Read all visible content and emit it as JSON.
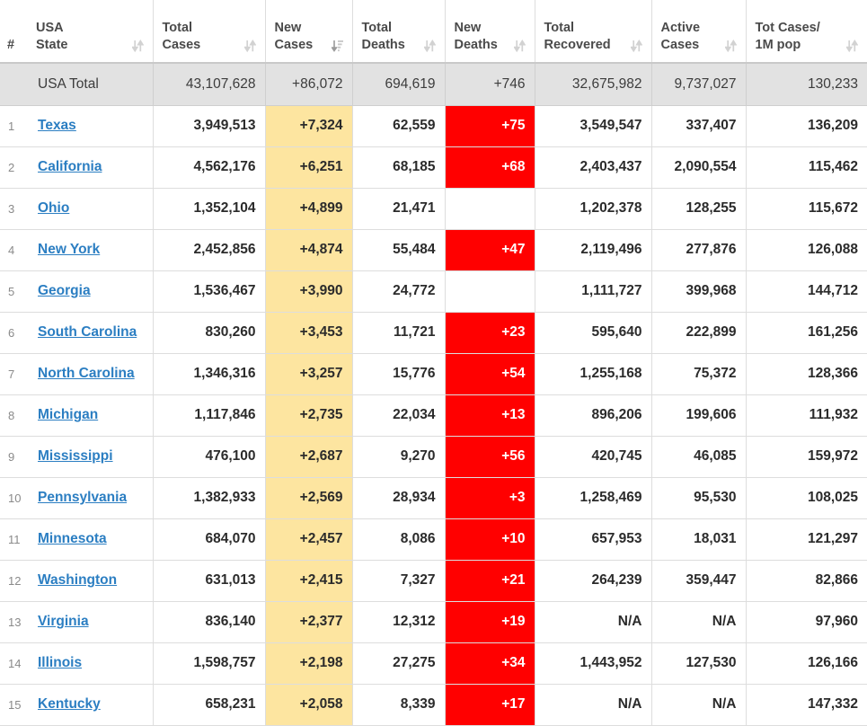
{
  "table": {
    "columns": [
      {
        "key": "rank",
        "label_line1": "",
        "label_line2": "#",
        "sort_icon": "none"
      },
      {
        "key": "state",
        "label_line1": "USA",
        "label_line2": "State",
        "sort_icon": "sort-updown-icon"
      },
      {
        "key": "tc",
        "label_line1": "Total",
        "label_line2": "Cases",
        "sort_icon": "sort-updown-icon"
      },
      {
        "key": "nc",
        "label_line1": "New",
        "label_line2": "Cases",
        "sort_icon": "sort-amount-desc-icon"
      },
      {
        "key": "td",
        "label_line1": "Total",
        "label_line2": "Deaths",
        "sort_icon": "sort-updown-icon"
      },
      {
        "key": "nd",
        "label_line1": "New",
        "label_line2": "Deaths",
        "sort_icon": "sort-updown-icon"
      },
      {
        "key": "tr",
        "label_line1": "Total",
        "label_line2": "Recovered",
        "sort_icon": "sort-updown-icon"
      },
      {
        "key": "ac",
        "label_line1": "Active",
        "label_line2": "Cases",
        "sort_icon": "sort-updown-icon"
      },
      {
        "key": "tcm",
        "label_line1": "Tot Cases/",
        "label_line2": "1M pop",
        "sort_icon": "sort-updown-icon"
      }
    ],
    "total_row": {
      "rank": "",
      "state": "USA Total",
      "total_cases": "43,107,628",
      "new_cases": "+86,072",
      "total_deaths": "694,619",
      "new_deaths": "+746",
      "total_recovered": "32,675,982",
      "active_cases": "9,737,027",
      "tot_cases_1m": "130,233"
    },
    "rows": [
      {
        "rank": "1",
        "state": "Texas",
        "total_cases": "3,949,513",
        "new_cases": "+7,324",
        "total_deaths": "62,559",
        "new_deaths": "+75",
        "total_recovered": "3,549,547",
        "active_cases": "337,407",
        "tot_cases_1m": "136,209"
      },
      {
        "rank": "2",
        "state": "California",
        "total_cases": "4,562,176",
        "new_cases": "+6,251",
        "total_deaths": "68,185",
        "new_deaths": "+68",
        "total_recovered": "2,403,437",
        "active_cases": "2,090,554",
        "tot_cases_1m": "115,462"
      },
      {
        "rank": "3",
        "state": "Ohio",
        "total_cases": "1,352,104",
        "new_cases": "+4,899",
        "total_deaths": "21,471",
        "new_deaths": "",
        "total_recovered": "1,202,378",
        "active_cases": "128,255",
        "tot_cases_1m": "115,672"
      },
      {
        "rank": "4",
        "state": "New York",
        "total_cases": "2,452,856",
        "new_cases": "+4,874",
        "total_deaths": "55,484",
        "new_deaths": "+47",
        "total_recovered": "2,119,496",
        "active_cases": "277,876",
        "tot_cases_1m": "126,088"
      },
      {
        "rank": "5",
        "state": "Georgia",
        "total_cases": "1,536,467",
        "new_cases": "+3,990",
        "total_deaths": "24,772",
        "new_deaths": "",
        "total_recovered": "1,111,727",
        "active_cases": "399,968",
        "tot_cases_1m": "144,712"
      },
      {
        "rank": "6",
        "state": "South Carolina",
        "total_cases": "830,260",
        "new_cases": "+3,453",
        "total_deaths": "11,721",
        "new_deaths": "+23",
        "total_recovered": "595,640",
        "active_cases": "222,899",
        "tot_cases_1m": "161,256"
      },
      {
        "rank": "7",
        "state": "North Carolina",
        "total_cases": "1,346,316",
        "new_cases": "+3,257",
        "total_deaths": "15,776",
        "new_deaths": "+54",
        "total_recovered": "1,255,168",
        "active_cases": "75,372",
        "tot_cases_1m": "128,366"
      },
      {
        "rank": "8",
        "state": "Michigan",
        "total_cases": "1,117,846",
        "new_cases": "+2,735",
        "total_deaths": "22,034",
        "new_deaths": "+13",
        "total_recovered": "896,206",
        "active_cases": "199,606",
        "tot_cases_1m": "111,932"
      },
      {
        "rank": "9",
        "state": "Mississippi",
        "total_cases": "476,100",
        "new_cases": "+2,687",
        "total_deaths": "9,270",
        "new_deaths": "+56",
        "total_recovered": "420,745",
        "active_cases": "46,085",
        "tot_cases_1m": "159,972"
      },
      {
        "rank": "10",
        "state": "Pennsylvania",
        "total_cases": "1,382,933",
        "new_cases": "+2,569",
        "total_deaths": "28,934",
        "new_deaths": "+3",
        "total_recovered": "1,258,469",
        "active_cases": "95,530",
        "tot_cases_1m": "108,025"
      },
      {
        "rank": "11",
        "state": "Minnesota",
        "total_cases": "684,070",
        "new_cases": "+2,457",
        "total_deaths": "8,086",
        "new_deaths": "+10",
        "total_recovered": "657,953",
        "active_cases": "18,031",
        "tot_cases_1m": "121,297"
      },
      {
        "rank": "12",
        "state": "Washington",
        "total_cases": "631,013",
        "new_cases": "+2,415",
        "total_deaths": "7,327",
        "new_deaths": "+21",
        "total_recovered": "264,239",
        "active_cases": "359,447",
        "tot_cases_1m": "82,866"
      },
      {
        "rank": "13",
        "state": "Virginia",
        "total_cases": "836,140",
        "new_cases": "+2,377",
        "total_deaths": "12,312",
        "new_deaths": "+19",
        "total_recovered": "N/A",
        "active_cases": "N/A",
        "tot_cases_1m": "97,960"
      },
      {
        "rank": "14",
        "state": "Illinois",
        "total_cases": "1,598,757",
        "new_cases": "+2,198",
        "total_deaths": "27,275",
        "new_deaths": "+34",
        "total_recovered": "1,443,952",
        "active_cases": "127,530",
        "tot_cases_1m": "126,166"
      },
      {
        "rank": "15",
        "state": "Kentucky",
        "total_cases": "658,231",
        "new_cases": "+2,058",
        "total_deaths": "8,339",
        "new_deaths": "+17",
        "total_recovered": "N/A",
        "active_cases": "N/A",
        "tot_cases_1m": "147,332"
      }
    ]
  },
  "colors": {
    "new_cases_highlight": "#fde5a0",
    "new_deaths_highlight": "#ff0000",
    "total_row_background": "#e2e2e2",
    "link": "#2b7ec2",
    "border": "#dddddd"
  }
}
